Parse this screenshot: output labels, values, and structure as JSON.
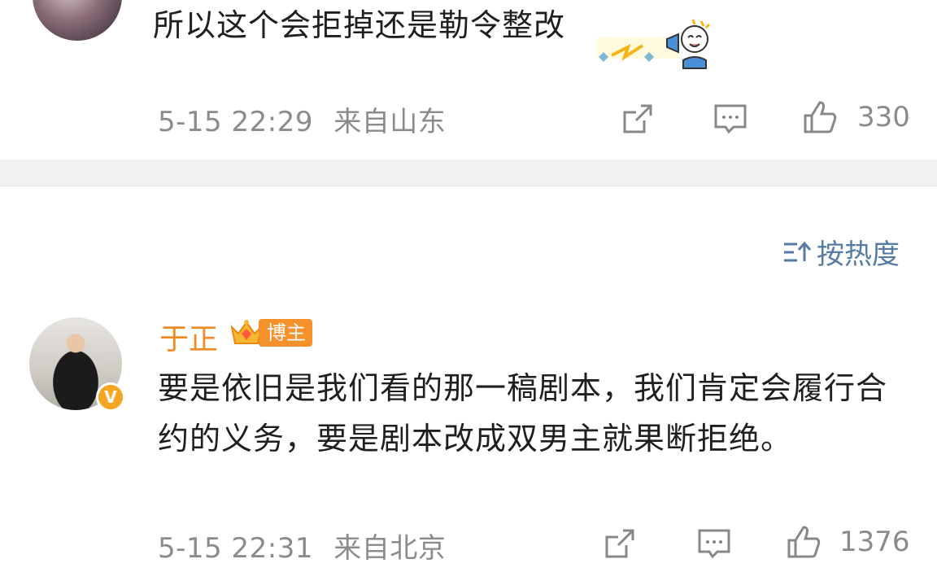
{
  "top_comment": {
    "text": "所以这个会拒掉还是勒令整改",
    "time": "5-15 22:29",
    "location": "来自山东",
    "likes": "330"
  },
  "sort": {
    "label": "按热度"
  },
  "main_comment": {
    "username": "于正",
    "badge": "博主",
    "text": "要是依旧是我们看的那一稿剧本，我们肯定会履行合约的义务，要是剧本改成双男主就果断拒绝。",
    "time": "5-15 22:31",
    "location": "来自北京",
    "likes": "1376",
    "verify_mark": "V"
  },
  "icons": [
    "share-icon",
    "comment-icon",
    "like-icon",
    "sort-icon",
    "crown-icon"
  ],
  "colors": {
    "username": "#f08a24",
    "sort": "#557aa4",
    "meta": "#8b8b8b",
    "badge": "#f5902b"
  }
}
